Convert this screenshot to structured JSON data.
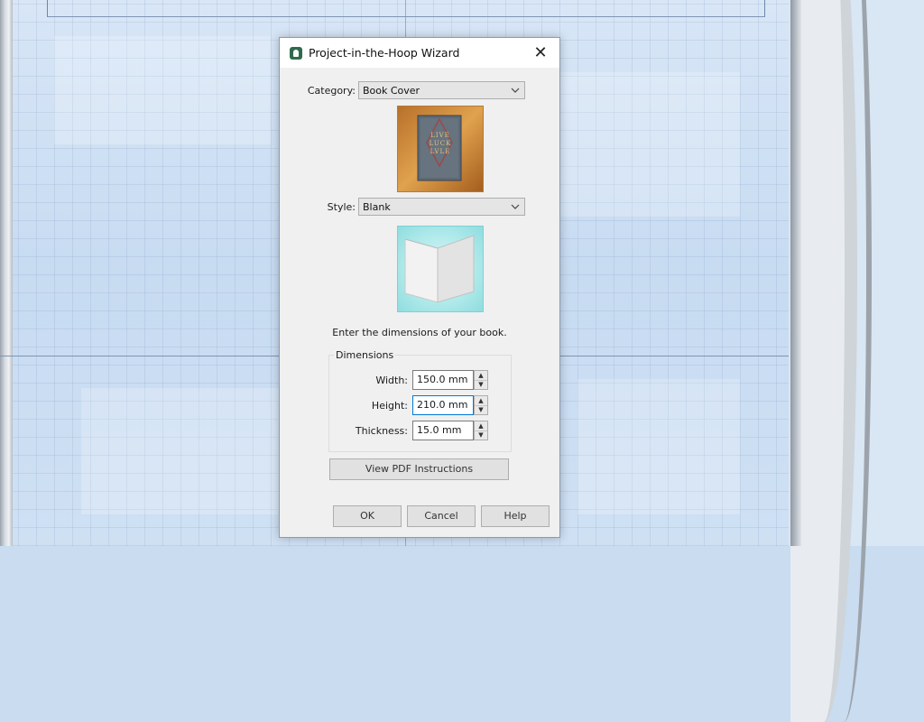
{
  "dialog": {
    "title": "Project-in-the-Hoop Wizard",
    "close_glyph": "✕",
    "category": {
      "label": "Category:",
      "value": "Book Cover"
    },
    "style": {
      "label": "Style:",
      "value": "Blank"
    },
    "cover_art_text": [
      "LIVE",
      "LUCK",
      "LVLE"
    ],
    "prompt": "Enter the dimensions of your book.",
    "dimensions": {
      "group_title": "Dimensions",
      "width": {
        "label": "Width:",
        "value": "150.0 mm"
      },
      "height": {
        "label": "Height:",
        "value": "210.0 mm"
      },
      "thickness": {
        "label": "Thickness:",
        "value": "15.0 mm"
      }
    },
    "pdf_button": "View PDF Instructions",
    "ok_button": "OK",
    "cancel_button": "Cancel",
    "help_button": "Help"
  },
  "icons": {
    "app": "app-hoop-icon",
    "close": "close-icon",
    "dropdown": "chevron-down-icon",
    "spin_up": "spin-up-arrow-icon",
    "spin_down": "spin-down-arrow-icon"
  },
  "colors": {
    "title_bar": "#ffffff",
    "dialog_bg": "#f0f0f0",
    "focus_border": "#0078d7",
    "canvas_bg": "#c9dcf0"
  }
}
